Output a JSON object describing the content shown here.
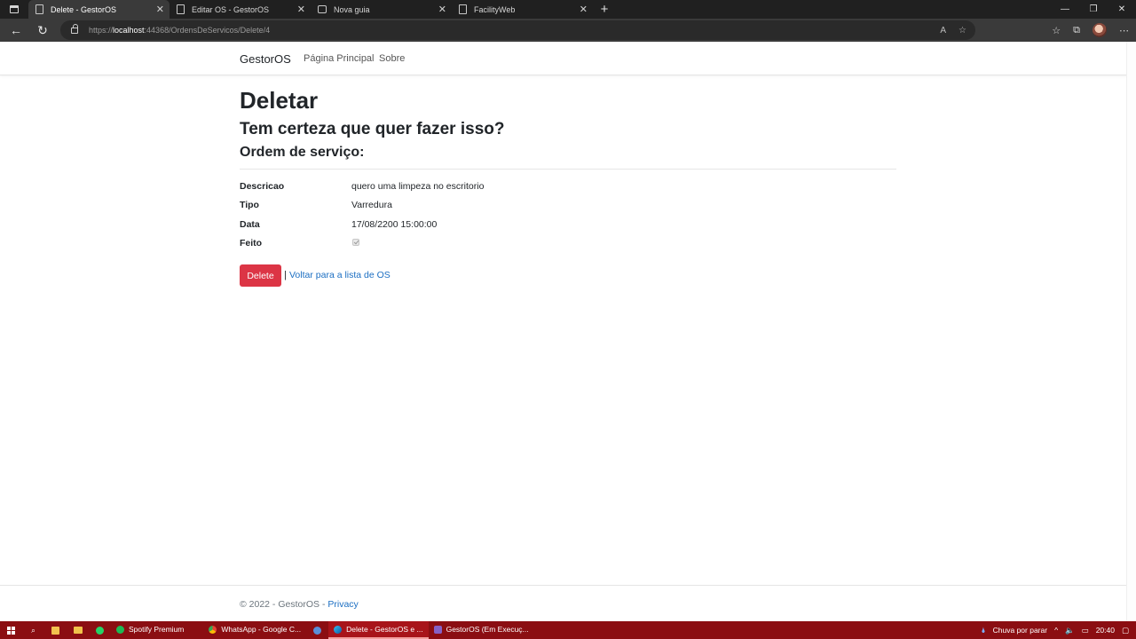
{
  "browser": {
    "tabs": [
      {
        "label": "Delete - GestorOS",
        "active": true
      },
      {
        "label": "Editar OS - GestorOS",
        "active": false
      },
      {
        "label": "Nova guia",
        "active": false
      },
      {
        "label": "FacilityWeb",
        "active": false
      }
    ],
    "address": {
      "prefix": "https://",
      "host": "localhost",
      "rest": ":44368/OrdensDeServicos/Delete/4"
    }
  },
  "nav": {
    "brand": "GestorOS",
    "links": [
      "Página Principal",
      "Sobre"
    ]
  },
  "page": {
    "title": "Deletar",
    "question": "Tem certeza que quer fazer isso?",
    "section": "Ordem de serviço:",
    "fields": [
      {
        "label": "Descricao",
        "value": "quero uma limpeza no escritorio"
      },
      {
        "label": "Tipo",
        "value": "Varredura"
      },
      {
        "label": "Data",
        "value": "17/08/2200 15:00:00"
      },
      {
        "label": "Feito",
        "value": ""
      }
    ],
    "delete_label": "Delete",
    "separator": "|",
    "back_link": "Voltar para a lista de OS"
  },
  "footer": {
    "copyright": "© 2022 - GestorOS - ",
    "privacy": "Privacy"
  },
  "taskbar": {
    "apps": [
      {
        "label": "Spotify Premium",
        "color": "#1db954",
        "active": false
      },
      {
        "label": "WhatsApp - Google C...",
        "color": "#4285f4",
        "active": false
      },
      {
        "label": "Delete - GestorOS e ...",
        "color": "#1a8fd9",
        "active": true
      },
      {
        "label": "GestorOS (Em Execuç...",
        "color": "#8661c5",
        "active": false
      }
    ],
    "weather": "Chuva por parar",
    "time": "20:40"
  },
  "colors": {
    "danger": "#dc3545",
    "link": "#1b6ec2",
    "taskbar": "#8b0e12"
  }
}
